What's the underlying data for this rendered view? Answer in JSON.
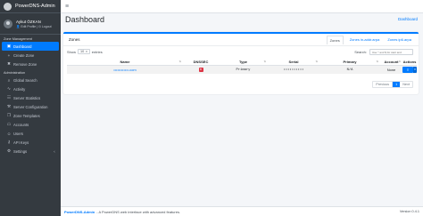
{
  "brand": {
    "title": "PowerDNS-Admin"
  },
  "user": {
    "name": "Aykut ÖZKAN",
    "links": "👤 Edit Profile  | ⏻ Logout"
  },
  "sidebar": {
    "zone_management_header": "Zone Management",
    "zone_items": [
      {
        "label": "Dashboard",
        "icon": "dashboard-icon",
        "glyph": "▣"
      },
      {
        "label": "Create Zone",
        "icon": "plus-icon",
        "glyph": "+"
      },
      {
        "label": "Remove Zone",
        "icon": "trash-icon",
        "glyph": "✖"
      }
    ],
    "administration_header": "Administration",
    "admin_items": [
      {
        "label": "Global Search",
        "icon": "search-icon",
        "glyph": "⌕"
      },
      {
        "label": "Activity",
        "icon": "activity-icon",
        "glyph": "∿"
      },
      {
        "label": "Server Statistics",
        "icon": "chart-icon",
        "glyph": "☷"
      },
      {
        "label": "Server Configuration",
        "icon": "wrench-icon",
        "glyph": "⚒"
      },
      {
        "label": "Zone Templates",
        "icon": "clone-icon",
        "glyph": "❐"
      },
      {
        "label": "Accounts",
        "icon": "accounts-icon",
        "glyph": "☖"
      },
      {
        "label": "Users",
        "icon": "users-icon",
        "glyph": "☺"
      },
      {
        "label": "API Keys",
        "icon": "key-icon",
        "glyph": "⚷"
      },
      {
        "label": "Settings",
        "icon": "gear-icon",
        "glyph": "⚙"
      }
    ]
  },
  "header": {
    "title": "Dashboard",
    "breadcrumb": "Dashboard"
  },
  "zones": {
    "title": "Zones",
    "tabs": [
      "Zones",
      "Zones in-addr.arpa",
      "Zones ip6.arpa"
    ],
    "show_label": "Show",
    "entries_value": "10",
    "entries_label": "entries",
    "search_label": "Search:",
    "search_placeholder": "Use ^ and $ for start and",
    "columns": [
      "Name",
      "DNSSEC",
      "Type",
      "Serial",
      "Primary",
      "Account",
      "Actions"
    ],
    "rows": [
      {
        "name": "••••••••••••.com",
        "dnssec": "✕",
        "type": "Primary",
        "serial": "••••••••••",
        "primary": "N/A",
        "account": "None",
        "action_glyph": "≡"
      }
    ],
    "pagination": {
      "previous": "Previous",
      "current": "1",
      "next": "Next"
    }
  },
  "footer": {
    "brand": "PowerDNS-Admin",
    "text": "- A PowerDNS web interface with advanced features.",
    "version": "Version 0.4.1"
  }
}
